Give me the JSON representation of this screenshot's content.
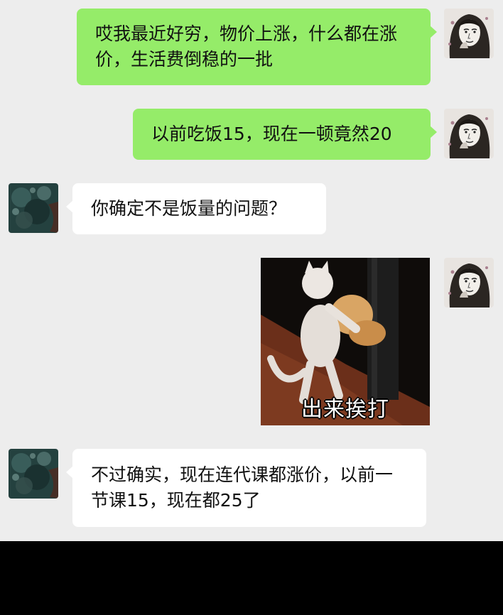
{
  "chat": {
    "messages": [
      {
        "sender": "me",
        "text": "哎我最近好穷，物价上涨，什么都在涨价，生活费倒稳的一批"
      },
      {
        "sender": "me",
        "text": "以前吃饭15，现在一顿竟然20"
      },
      {
        "sender": "other",
        "text": "你确定不是饭量的问题？"
      },
      {
        "sender": "me",
        "sticker_caption": "出来挨打"
      },
      {
        "sender": "other",
        "text": "不过确实，现在连代课都涨价，以前一节课15，现在都25了"
      }
    ]
  },
  "colors": {
    "background": "#ededed",
    "my_bubble": "#95ec69",
    "their_bubble": "#ffffff",
    "bottom_bar": "#000000"
  },
  "icons": {
    "my_avatar": "woman-sketch-avatar",
    "their_avatar": "dark-teal-texture-avatar"
  }
}
